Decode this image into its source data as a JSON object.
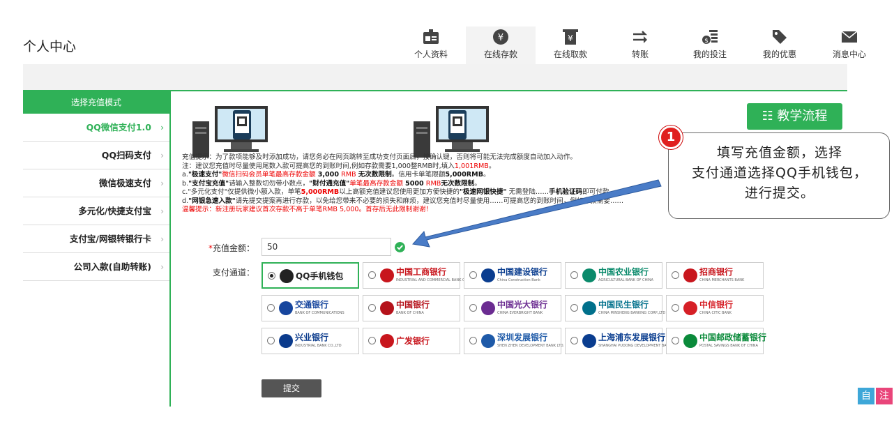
{
  "header": {
    "title": "个人中心",
    "nav": [
      {
        "label": "个人资料",
        "icon": "id-card-icon"
      },
      {
        "label": "在线存款",
        "icon": "yen-coin-icon"
      },
      {
        "label": "在线取款",
        "icon": "yen-withdraw-icon"
      },
      {
        "label": "转账",
        "icon": "transfer-arrows-icon"
      },
      {
        "label": "我的投注",
        "icon": "money-list-icon"
      },
      {
        "label": "我的优惠",
        "icon": "tag-icon"
      },
      {
        "label": "消息中心",
        "icon": "envelope-icon"
      }
    ],
    "active_nav": "在线存款"
  },
  "sidebar": {
    "heading": "选择充值模式",
    "items": [
      {
        "label": "QQ微信支付1.0"
      },
      {
        "label": "QQ扫码支付"
      },
      {
        "label": "微信极速支付"
      },
      {
        "label": "多元化/快捷支付宝"
      },
      {
        "label": "支付宝/网银转银行卡"
      },
      {
        "label": "公司入款(自助转账)"
      }
    ],
    "active_index": 0,
    "chevron": "›"
  },
  "main": {
    "tutorial_button": "☷ 教学流程",
    "tips": {
      "line1": "充值提示：为了款项能够及时添加成功，请您务必在网页跳转至成功支付页面后，按确认键，否则将可能无法完成额度自动加入动作。",
      "line2_a": "注：建议您充值时尽量使用尾数入款可提高您的到账时间,例如存款需要1,000整RMB时,填入",
      "line2_b": "1,001RMB",
      "line2_c": "。",
      "line3_a": "a.",
      "line3_b": "\"极速支付\"",
      "line3_c": "微信扫码会员单笔最高存款金额",
      "line3_d": "3,000",
      "line3_e": "RMB",
      "line3_f": "无次数限制",
      "line3_g": "。信用卡单笔限额",
      "line3_h": "5,000RMB",
      "line3_i": "。",
      "line4_a": "b.",
      "line4_b": "\"支付宝充值\"",
      "line4_c": "请输入整数切勿带小数点，",
      "line4_d": "\"财付通充值\"",
      "line4_e": "单笔最高存款金额",
      "line4_f": "5000",
      "line4_g": "RMB",
      "line4_h": "无次数限制",
      "line4_i": "。",
      "line5_a": "c.\"多元化支付\"仅提供微小额入款，单笔",
      "line5_b": "5,000RMB",
      "line5_c": "以上高额充值建议您使用更加方便快捷的",
      "line5_d": "\"极速网银快捷\"",
      "line5_e": "无需登陆……",
      "line5_f": "手机验证码",
      "line5_g": "即可付款。",
      "line6_a": "d.",
      "line6_b": "\"网银急速入款\"",
      "line6_c": "请先提交提案再进行存款，以免给您带来不必要的损失和麻烦，建议您充值时尽量使用……可提高您的到账时间，例如存款需要……",
      "line7": "温馨提示：新注册玩家建议首次存款不高于单笔RMB 5,000。首存后无此限制谢谢！"
    },
    "amount_label": "*充值金额：",
    "amount_value": "50",
    "channel_label": "支付通道：",
    "submit_label": "提交",
    "channels": [
      {
        "name": "QQ手机钱包",
        "sub": "",
        "color": "#222",
        "selected": true
      },
      {
        "name": "中国工商银行",
        "sub": "INDUSTRIAL AND COMMERCIAL BANK OF CHINA",
        "color": "#c8161d",
        "selected": false
      },
      {
        "name": "中国建设银行",
        "sub": "China Construction Bank",
        "color": "#0a3d8f",
        "selected": false
      },
      {
        "name": "中国农业银行",
        "sub": "AGRICULTURAL BANK OF CHINA",
        "color": "#0a8a6b",
        "selected": false
      },
      {
        "name": "招商银行",
        "sub": "CHINA MERCHANTS BANK",
        "color": "#c8161d",
        "selected": false
      },
      {
        "name": "交通银行",
        "sub": "BANK OF COMMUNICATIONS",
        "color": "#17469e",
        "selected": false
      },
      {
        "name": "中国银行",
        "sub": "BANK OF CHINA",
        "color": "#b5121b",
        "selected": false
      },
      {
        "name": "中国光大银行",
        "sub": "CHINA EVERBRIGHT BANK",
        "color": "#6b2c91",
        "selected": false
      },
      {
        "name": "中国民生银行",
        "sub": "CHINA MINSHENG BANKING CORP.,LTD",
        "color": "#00708b",
        "selected": false
      },
      {
        "name": "中信银行",
        "sub": "CHINA CITIC BANK",
        "color": "#d61f26",
        "selected": false
      },
      {
        "name": "兴业银行",
        "sub": "INDUSTRIAL BANK CO.,LTD",
        "color": "#0b3b8c",
        "selected": false
      },
      {
        "name": "广发银行",
        "sub": "",
        "color": "#c8161d",
        "selected": false
      },
      {
        "name": "深圳发展银行",
        "sub": "SHEN ZHEN DEVELOPMENT BANK LTD.",
        "color": "#1e5aa8",
        "selected": false
      },
      {
        "name": "上海浦东发展银行",
        "sub": "SHANGHAI PUDONG DEVELOPMENT BANK",
        "color": "#0a3d8f",
        "selected": false
      },
      {
        "name": "中国邮政储蓄银行",
        "sub": "POSTAL SAVINGS BANK OF CHINA",
        "color": "#0a8a3a",
        "selected": false
      }
    ]
  },
  "callout": {
    "step": "1",
    "text_line1": "填写充值金额，选择",
    "text_line2": "支付通道选择QQ手机钱包，",
    "text_line3": "进行提交。"
  },
  "corner_buttons": [
    {
      "label": "自",
      "color": "#3ea7d8"
    },
    {
      "label": "注",
      "color": "#e9457a"
    }
  ],
  "colors": {
    "accent": "#2fb157",
    "warning": "#e00000",
    "arrow": "#4a7cc7"
  }
}
